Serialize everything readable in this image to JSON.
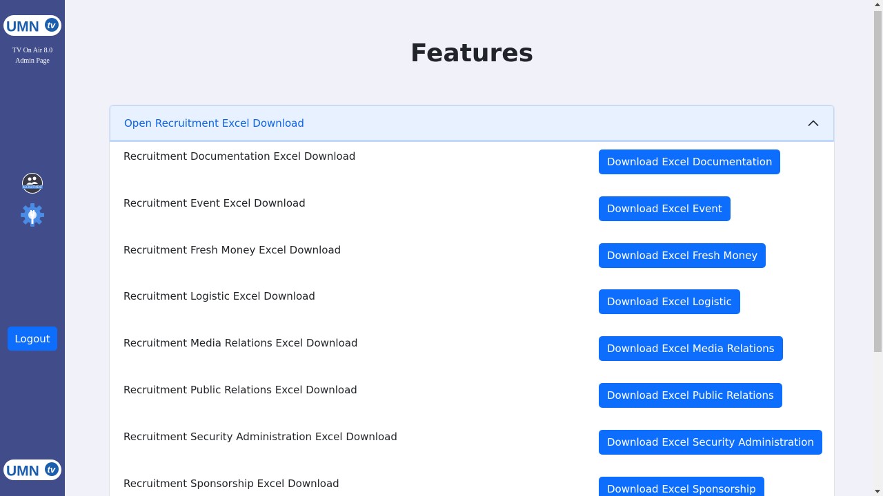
{
  "sidebar": {
    "logo_text": "UMN",
    "logo_badge": "tv",
    "subtitle_line1": "TV On Air 8.0",
    "subtitle_line2": "Admin Page",
    "recruitment_icon_text": "RECRUITMENT",
    "logout_label": "Logout"
  },
  "page": {
    "title": "Features"
  },
  "accordion": {
    "header_label": "Open Recruitment Excel Download",
    "rows": [
      {
        "label": "Recruitment Documentation Excel Download",
        "button": "Download Excel Documentation"
      },
      {
        "label": "Recruitment Event Excel Download",
        "button": "Download Excel Event"
      },
      {
        "label": "Recruitment Fresh Money Excel Download",
        "button": "Download Excel Fresh Money"
      },
      {
        "label": "Recruitment Logistic Excel Download",
        "button": "Download Excel Logistic"
      },
      {
        "label": "Recruitment Media Relations Excel Download",
        "button": "Download Excel Media Relations"
      },
      {
        "label": "Recruitment Public Relations Excel Download",
        "button": "Download Excel Public Relations"
      },
      {
        "label": "Recruitment Security Administration Excel Download",
        "button": "Download Excel Security Administration"
      },
      {
        "label": "Recruitment Sponsorship Excel Download",
        "button": "Download Excel Sponsorship"
      }
    ]
  },
  "colors": {
    "sidebar_bg": "#414d8b",
    "primary": "#0d6efd",
    "accordion_header_bg": "#e7f1ff",
    "accordion_header_text": "#0c63e4",
    "page_bg": "#f1f1fa"
  }
}
